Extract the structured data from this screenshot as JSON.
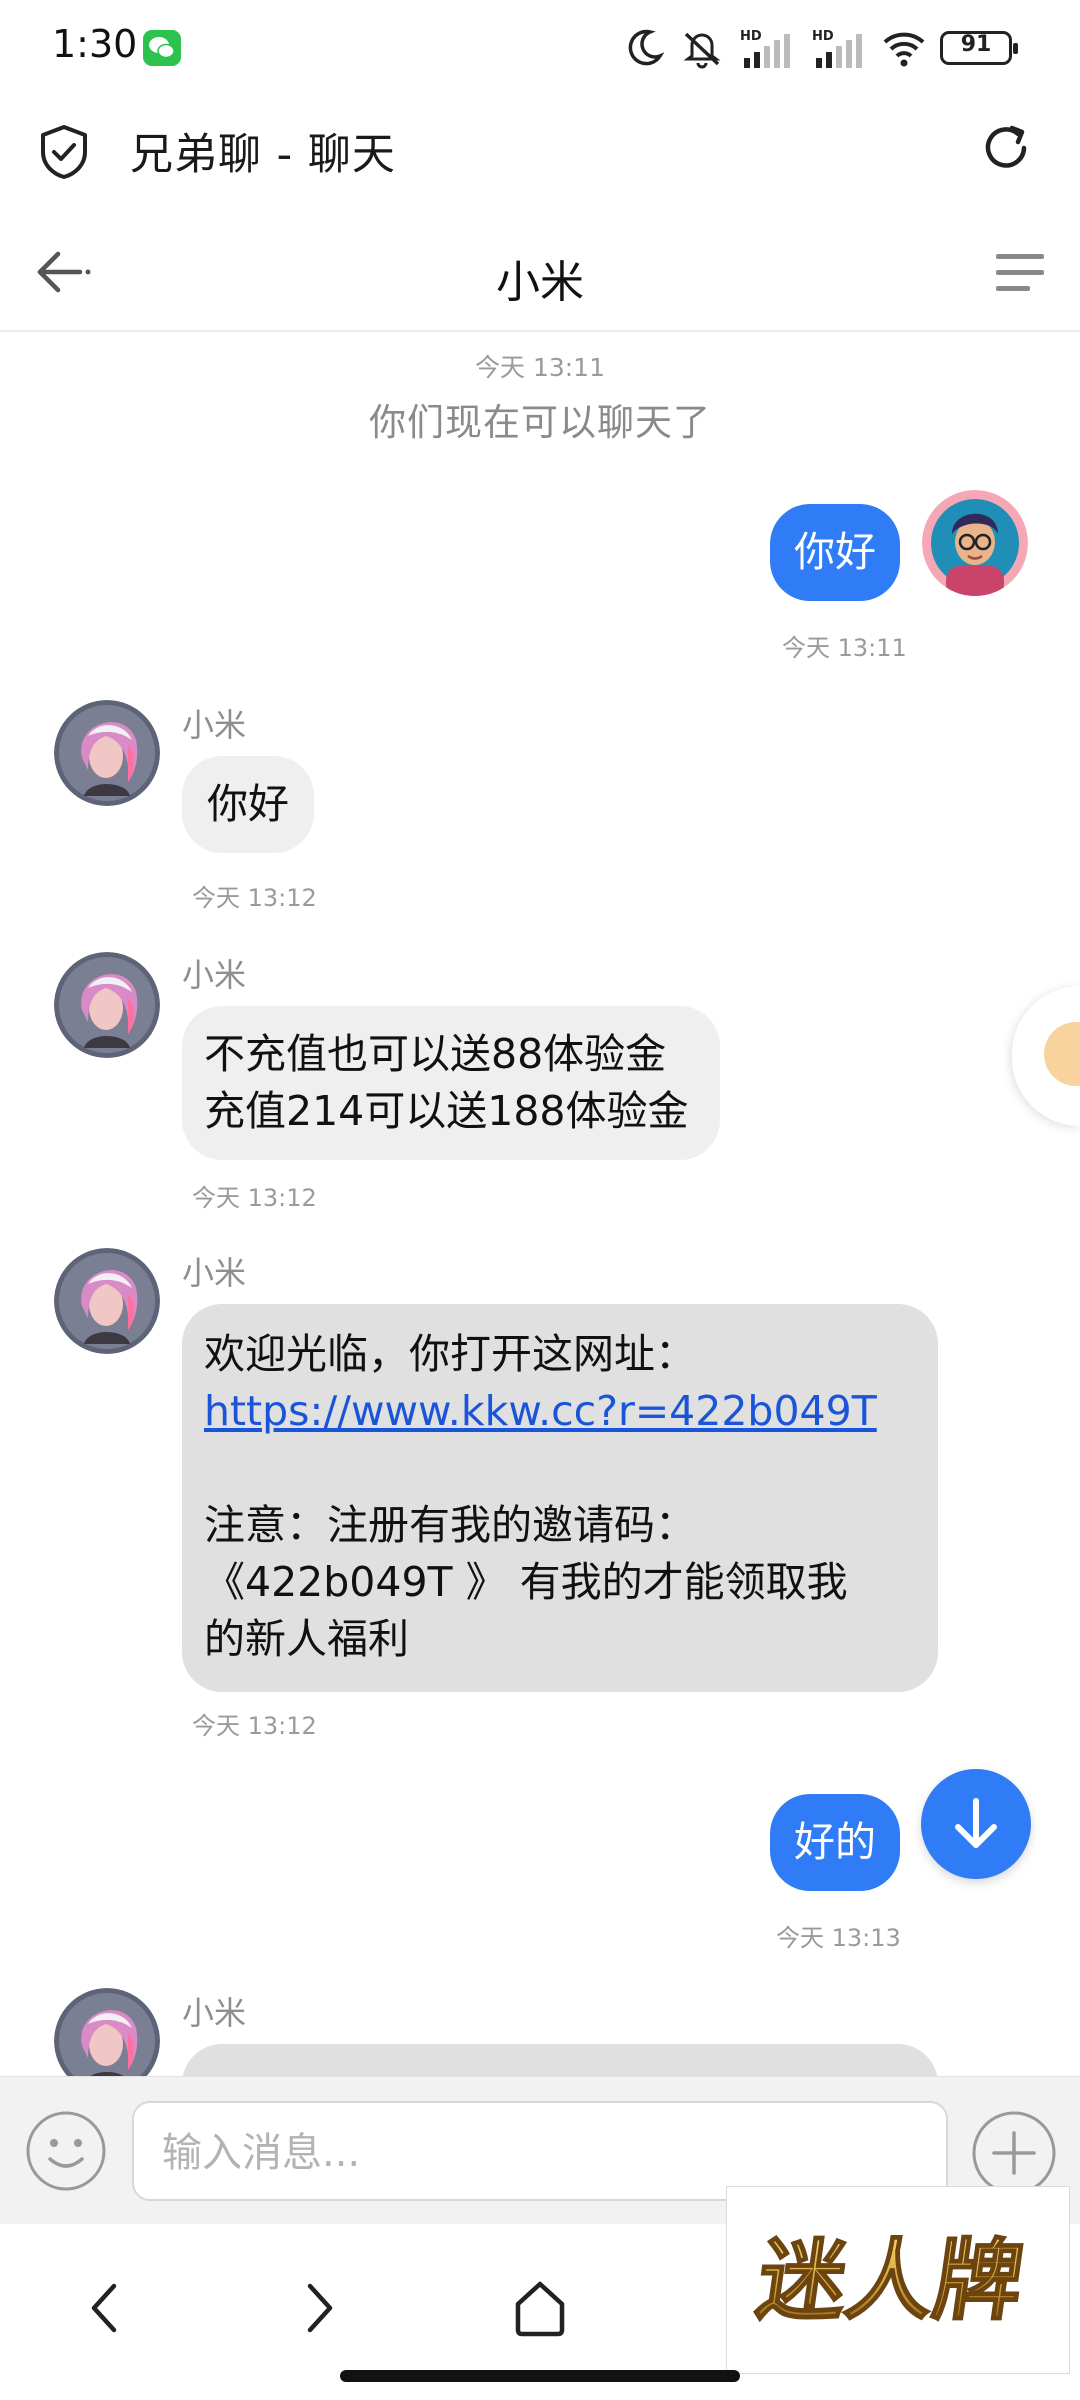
{
  "status_bar": {
    "time": "1:30",
    "battery": "91",
    "icons": [
      "wechat-notification-icon",
      "moon-icon",
      "mute-icon",
      "hd-signal-icon",
      "hd-signal-icon",
      "wifi-icon",
      "battery-icon"
    ]
  },
  "app_bar": {
    "title": "兄弟聊 - 聊天",
    "left_icon": "shield-check-icon",
    "right_icon": "refresh-icon"
  },
  "chat_header": {
    "title": "小米",
    "back_icon": "back-arrow-icon",
    "menu_icon": "menu-icon"
  },
  "chat": {
    "system": {
      "time": "今天 13:11",
      "text": "你们现在可以聊天了"
    },
    "messages": [
      {
        "direction": "out",
        "lines": [
          "你好"
        ],
        "time": "今天 13:11"
      },
      {
        "direction": "in",
        "sender": "小米",
        "lines": [
          "你好"
        ],
        "time": "今天 13:12"
      },
      {
        "direction": "in",
        "sender": "小米",
        "lines": [
          "不充值也可以送88体验金",
          "充值214可以送188体验金"
        ],
        "time": "今天 13:12"
      },
      {
        "direction": "in",
        "sender": "小米",
        "line1": "欢迎光临，你打开这网址：",
        "link": "https://www.kkw.cc?r=422b049T",
        "line3": "注意：注册有我的邀请码：",
        "line4": "《422b049T 》 有我的才能领取我",
        "line5": "的新人福利",
        "time": "今天 13:12"
      },
      {
        "direction": "out",
        "lines": [
          "好的"
        ],
        "time": "今天 13:13"
      },
      {
        "direction": "in",
        "sender": "小米",
        "lines": [
          "..."
        ]
      }
    ]
  },
  "input_bar": {
    "placeholder": "输入消息...",
    "emoji_icon": "emoji-icon",
    "plus_icon": "plus-icon"
  },
  "nav_bar": {
    "icons": [
      "back-chevron-icon",
      "forward-chevron-icon",
      "home-icon"
    ]
  },
  "watermark": {
    "text": "迷人牌"
  },
  "colors": {
    "accent": "#2f7cf6",
    "bubble_in": "#efefef",
    "bubble_in_long": "#e0e0e0",
    "link": "#1a55d9",
    "watermark_gold": "#d9a93a"
  }
}
